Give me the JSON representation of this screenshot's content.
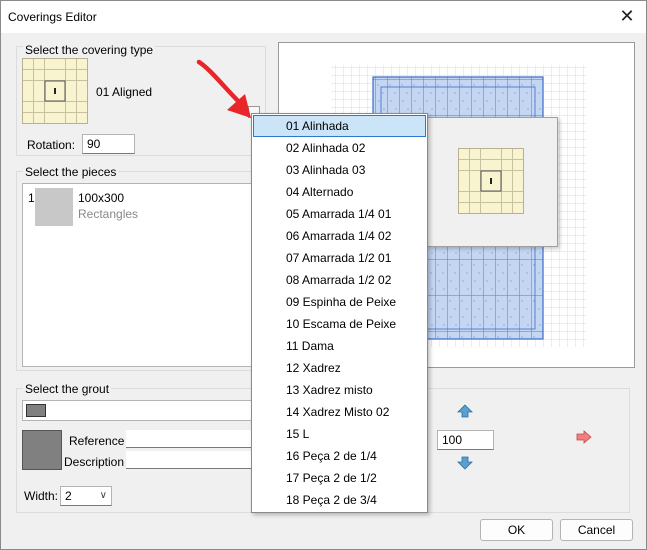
{
  "window": {
    "title": "Coverings Editor"
  },
  "covering_type": {
    "group_label": "Select the covering type",
    "selected_name": "01 Aligned",
    "rotation_label": "Rotation:",
    "rotation_value": "90"
  },
  "pieces": {
    "group_label": "Select the pieces",
    "items": [
      {
        "index": "1",
        "size": "100x300",
        "shape": "Rectangles"
      }
    ]
  },
  "grout": {
    "group_label": "Select the grout",
    "reference_label": "Reference",
    "description_label": "Description",
    "reference_value": "",
    "description_value": "",
    "width_label": "Width:",
    "width_value": "2",
    "color": "#808080",
    "spin_value": "100"
  },
  "dropdown": {
    "items": [
      "01 Alinhada",
      "02 Alinhada 02",
      "03 Alinhada 03",
      "04 Alternado",
      "05 Amarrada 1/4 01",
      "06 Amarrada 1/4 02",
      "07 Amarrada 1/2 01",
      "08 Amarrada 1/2 02",
      "09 Espinha de Peixe",
      "10 Escama de Peixe",
      "11 Dama",
      "12 Xadrez",
      "13 Xadrez misto",
      "14 Xadrez Misto 02",
      "15 L",
      "16 Peça 2 de 1/4",
      "17 Peça 2 de 1/2",
      "18 Peça 2 de 3/4"
    ],
    "selected_index": 0
  },
  "buttons": {
    "ok": "OK",
    "cancel": "Cancel"
  },
  "colors": {
    "accent": "#2a78d0",
    "selection_bg": "#cce4f7",
    "tile_cream": "#f8f4d0",
    "arrow_red": "#e8262a",
    "preview_blue": "#4a7fd8"
  }
}
